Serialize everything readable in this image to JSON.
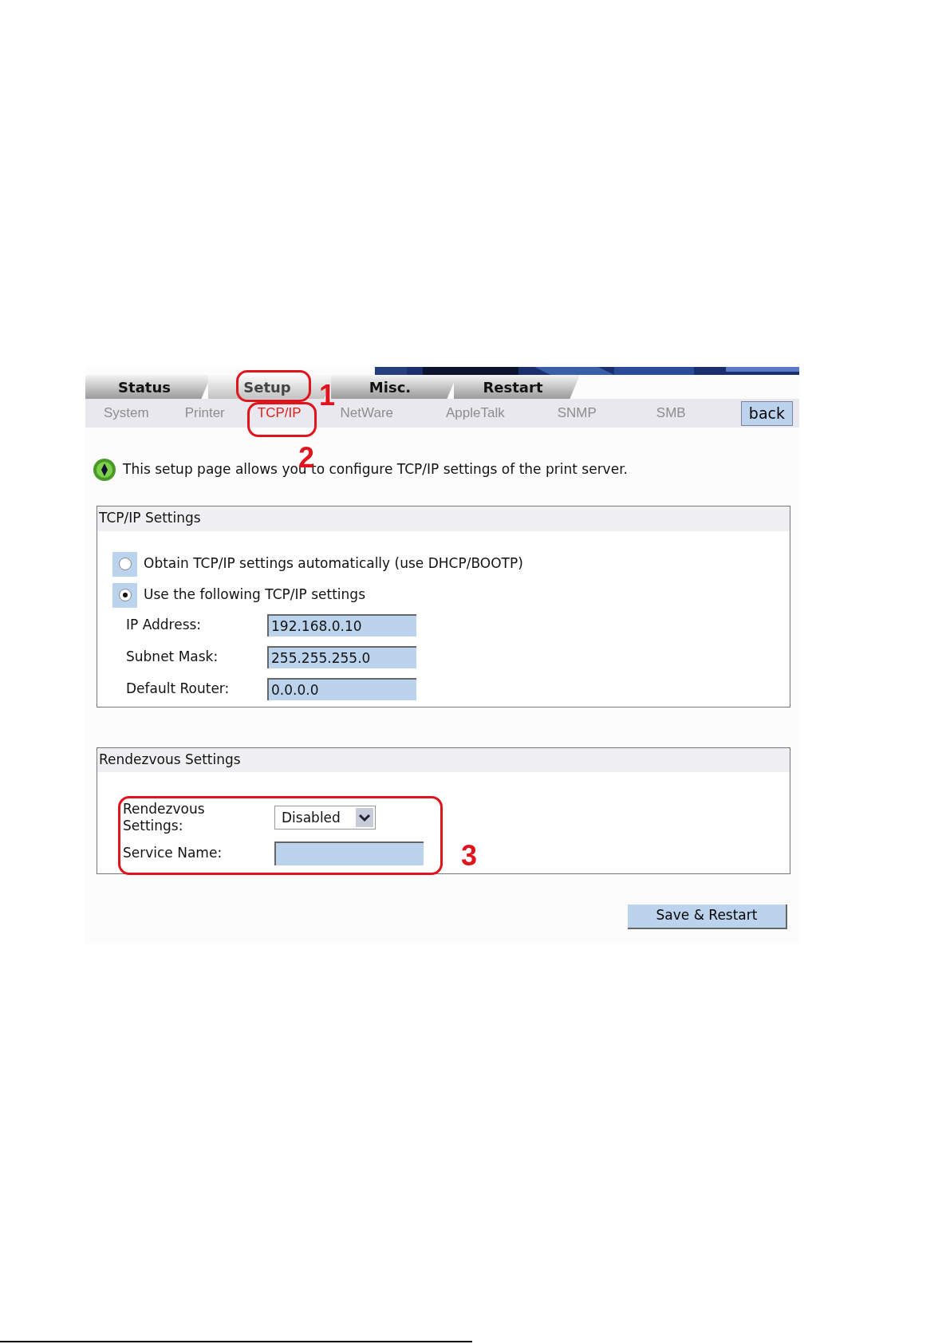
{
  "main_tabs": [
    {
      "label": "Status",
      "selected": false
    },
    {
      "label": "Setup",
      "selected": true
    },
    {
      "label": "Misc.",
      "selected": false
    },
    {
      "label": "Restart",
      "selected": false
    }
  ],
  "sub_tabs": [
    {
      "label": "System",
      "selected": false
    },
    {
      "label": "Printer",
      "selected": false
    },
    {
      "label": "TCP/IP",
      "selected": true
    },
    {
      "label": "NetWare",
      "selected": false
    },
    {
      "label": "AppleTalk",
      "selected": false
    },
    {
      "label": "SNMP",
      "selected": false
    },
    {
      "label": "SMB",
      "selected": false
    }
  ],
  "back_button": "back",
  "intro": "This setup page allows you to configure TCP/IP settings of the print server.",
  "tcpip": {
    "title": "TCP/IP Settings",
    "options": [
      {
        "label": "Obtain TCP/IP settings automatically (use DHCP/BOOTP)",
        "selected": false
      },
      {
        "label": "Use the following TCP/IP settings",
        "selected": true
      }
    ],
    "fields": [
      {
        "label": "IP Address:",
        "value": "192.168.0.10"
      },
      {
        "label": "Subnet Mask:",
        "value": "255.255.255.0"
      },
      {
        "label": "Default Router:",
        "value": "0.0.0.0"
      }
    ]
  },
  "rendezvous": {
    "title": "Rendezvous Settings",
    "setting": {
      "label": "Rendezvous Settings:",
      "value": "Disabled"
    },
    "service_name": {
      "label": "Service Name:"
    }
  },
  "save_button": "Save & Restart",
  "annotations": [
    {
      "label": "1"
    },
    {
      "label": "2"
    },
    {
      "label": "3"
    }
  ]
}
